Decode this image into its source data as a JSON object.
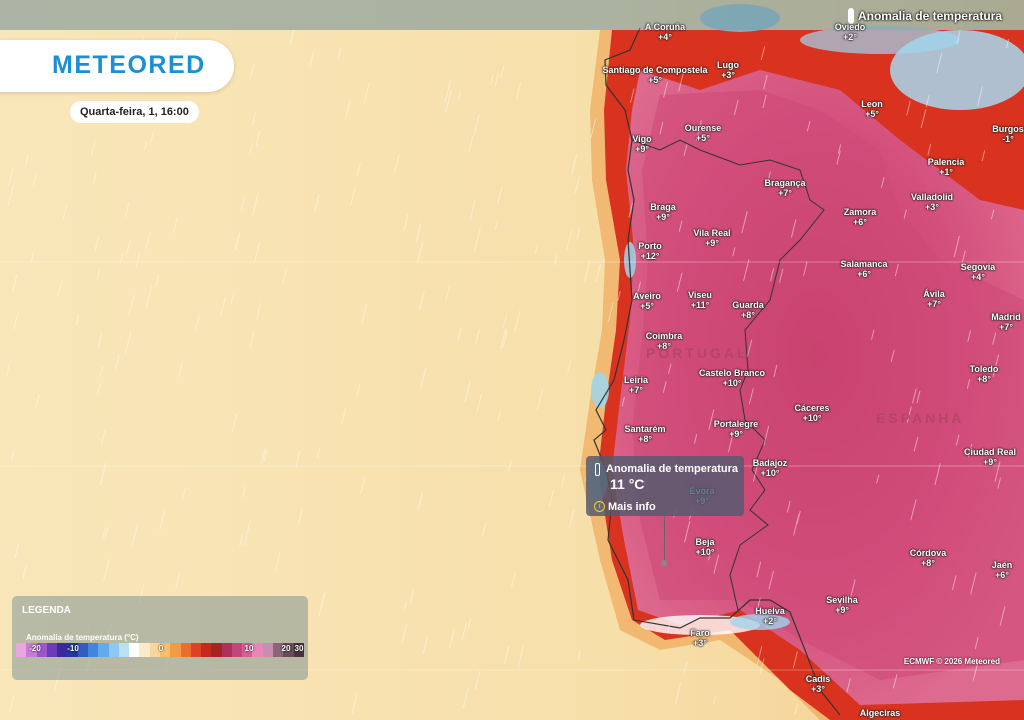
{
  "layer_title": "Anomalia de temperatura",
  "brand": "METEORED",
  "date": "Quarta-feira, 1, 16:00",
  "colors": {
    "sea_warm": "#f7e3b4",
    "land_anom": "#d9457a",
    "coast_hot": "#d9321f",
    "cool": "#9ed6ee",
    "accent": "#1a8fd6"
  },
  "cities": [
    {
      "name": "A Coruña",
      "value": "+4°"
    },
    {
      "name": "Lugo",
      "value": "+3°"
    },
    {
      "name": "Santiago de Compostela",
      "value": "+5°"
    },
    {
      "name": "Oviedo",
      "value": "+2°"
    },
    {
      "name": "Leon",
      "value": "+5°"
    },
    {
      "name": "Burgos",
      "value": "-1°"
    },
    {
      "name": "Vigo",
      "value": "+9°"
    },
    {
      "name": "Ourense",
      "value": "+5°"
    },
    {
      "name": "Bragança",
      "value": "+7°"
    },
    {
      "name": "Palencia",
      "value": "+1°"
    },
    {
      "name": "Valladolid",
      "value": "+3°"
    },
    {
      "name": "Braga",
      "value": "+9°"
    },
    {
      "name": "Zamora",
      "value": "+6°"
    },
    {
      "name": "Vila Real",
      "value": "+9°"
    },
    {
      "name": "Porto",
      "value": "+12°"
    },
    {
      "name": "Salamanca",
      "value": "+6°"
    },
    {
      "name": "Segovia",
      "value": "+4°"
    },
    {
      "name": "Aveiro",
      "value": "+5°"
    },
    {
      "name": "Viseu",
      "value": "+11°"
    },
    {
      "name": "Guarda",
      "value": "+8°"
    },
    {
      "name": "Ávila",
      "value": "+7°"
    },
    {
      "name": "Madrid",
      "value": "+7°"
    },
    {
      "name": "Coimbra",
      "value": "+8°"
    },
    {
      "name": "Castelo Branco",
      "value": "+10°"
    },
    {
      "name": "Toledo",
      "value": "+8°"
    },
    {
      "name": "Leiria",
      "value": "+7°"
    },
    {
      "name": "Cáceres",
      "value": "+10°"
    },
    {
      "name": "Portalegre",
      "value": "+9°"
    },
    {
      "name": "Santarém",
      "value": "+8°"
    },
    {
      "name": "Badajoz",
      "value": "+10°"
    },
    {
      "name": "Ciudad Real",
      "value": "+9°"
    },
    {
      "name": "Évora",
      "value": "+9°"
    },
    {
      "name": "Beja",
      "value": "+10°"
    },
    {
      "name": "Córdova",
      "value": "+8°"
    },
    {
      "name": "Jaén",
      "value": "+6°"
    },
    {
      "name": "Sevilha",
      "value": "+9°"
    },
    {
      "name": "Huelva",
      "value": "+2°"
    },
    {
      "name": "Faro",
      "value": "+3°"
    },
    {
      "name": "Cadis",
      "value": "+3°"
    },
    {
      "name": "Algeciras",
      "value": ""
    }
  ],
  "countries": {
    "pt": "PORTUGAL",
    "es": "ESPANHA"
  },
  "tooltip": {
    "title": "Anomalia de temperatura",
    "value": "11 °C",
    "more": "Mais info"
  },
  "legend": {
    "title": "LEGENDA",
    "subtitle": "Anomalia de temperatura (°C)",
    "ticks": [
      "-20",
      "-10",
      "0",
      "10",
      "20",
      "30"
    ],
    "colors": [
      "#e9a6e0",
      "#c87ad8",
      "#9d55cc",
      "#6c3cb8",
      "#3c2a9c",
      "#1f3a9e",
      "#2e5fc0",
      "#3f86dc",
      "#62aaea",
      "#8cc8f2",
      "#b9e0f7",
      "#ffffff",
      "#fbeacc",
      "#f8d69b",
      "#f6bd6a",
      "#f29a44",
      "#ec6e2e",
      "#de4123",
      "#c5291e",
      "#a52423",
      "#b0305a",
      "#c2467a",
      "#d65f9a",
      "#e887b8",
      "#c68fb0",
      "#8a6478",
      "#6a4a58",
      "#4a323e"
    ]
  },
  "attribution": "ECMWF © 2026 Meteored"
}
